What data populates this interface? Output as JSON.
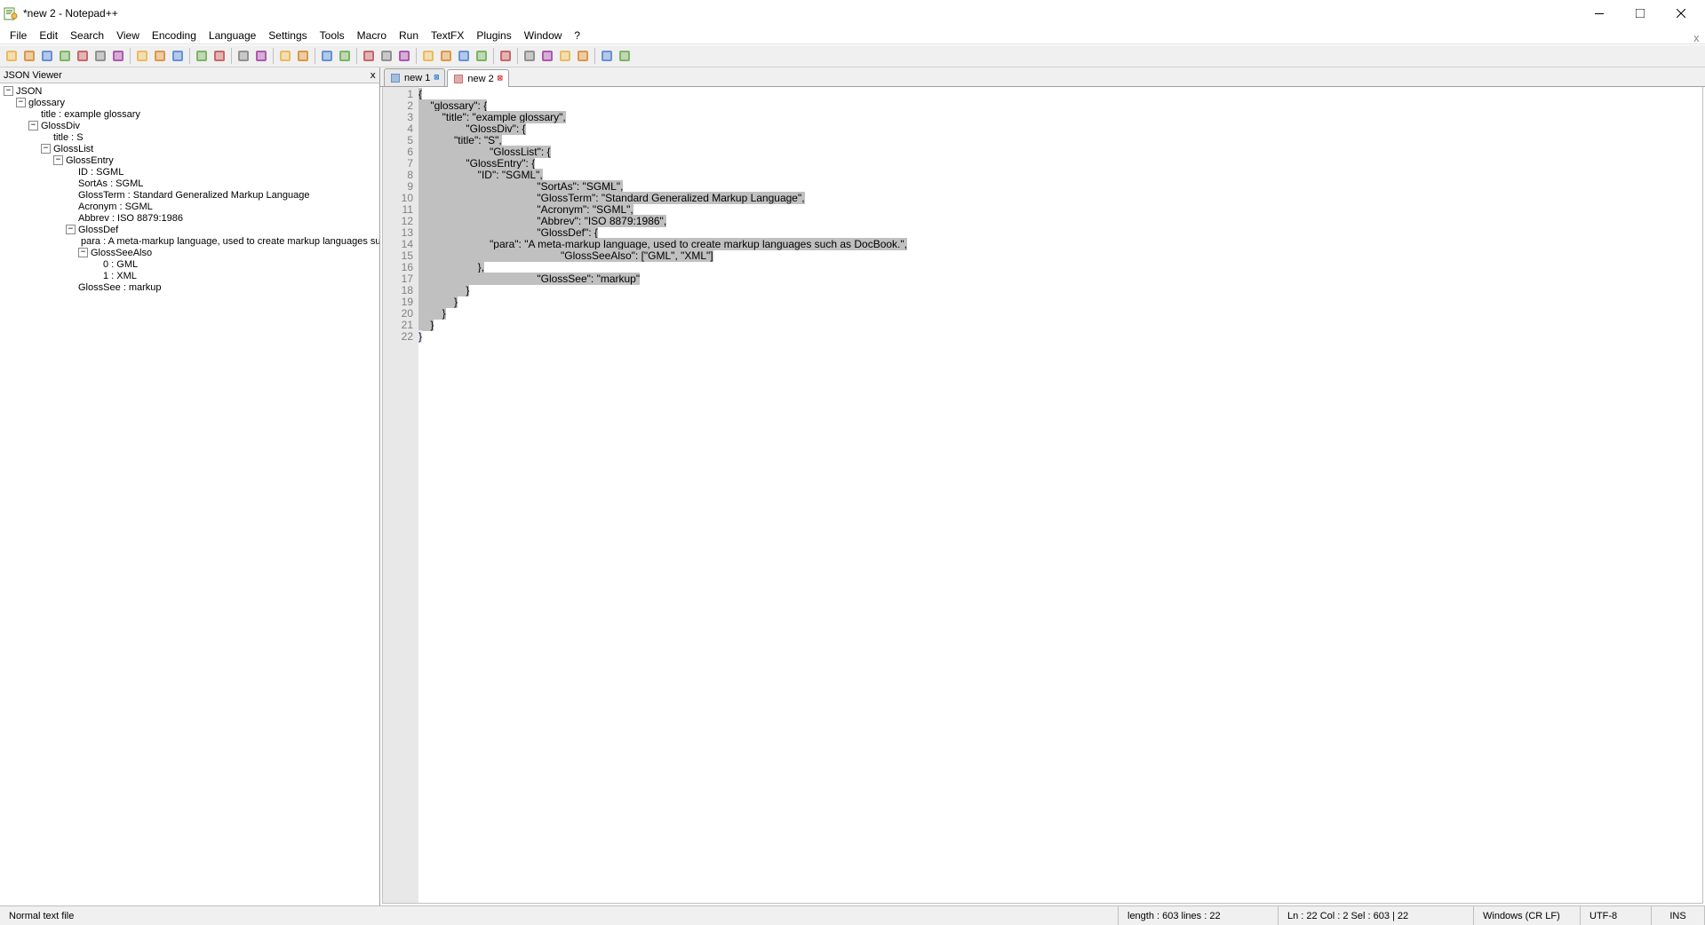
{
  "window": {
    "title": "*new 2 - Notepad++",
    "corner_close": "x"
  },
  "menu": [
    "File",
    "Edit",
    "Search",
    "View",
    "Encoding",
    "Language",
    "Settings",
    "Tools",
    "Macro",
    "Run",
    "TextFX",
    "Plugins",
    "Window",
    "?"
  ],
  "json_panel": {
    "title": "JSON Viewer",
    "close": "x"
  },
  "tree": [
    {
      "indent": 0,
      "toggle": "-",
      "label": "JSON"
    },
    {
      "indent": 1,
      "toggle": "-",
      "label": "glossary"
    },
    {
      "indent": 2,
      "toggle": "",
      "label": "title : example glossary"
    },
    {
      "indent": 2,
      "toggle": "-",
      "label": "GlossDiv"
    },
    {
      "indent": 3,
      "toggle": "",
      "label": "title : S"
    },
    {
      "indent": 3,
      "toggle": "-",
      "label": "GlossList"
    },
    {
      "indent": 4,
      "toggle": "-",
      "label": "GlossEntry"
    },
    {
      "indent": 5,
      "toggle": "",
      "label": "ID : SGML"
    },
    {
      "indent": 5,
      "toggle": "",
      "label": "SortAs : SGML"
    },
    {
      "indent": 5,
      "toggle": "",
      "label": "GlossTerm : Standard Generalized Markup Language"
    },
    {
      "indent": 5,
      "toggle": "",
      "label": "Acronym : SGML"
    },
    {
      "indent": 5,
      "toggle": "",
      "label": "Abbrev : ISO 8879:1986"
    },
    {
      "indent": 5,
      "toggle": "-",
      "label": "GlossDef"
    },
    {
      "indent": 6,
      "toggle": "",
      "label": "para : A meta-markup language, used to create markup languages such as DocBook."
    },
    {
      "indent": 6,
      "toggle": "-",
      "label": "GlossSeeAlso"
    },
    {
      "indent": 7,
      "toggle": "",
      "label": "0 : GML"
    },
    {
      "indent": 7,
      "toggle": "",
      "label": "1 : XML"
    },
    {
      "indent": 5,
      "toggle": "",
      "label": "GlossSee : markup"
    }
  ],
  "tabs": [
    {
      "label": "new 1",
      "active": false,
      "unsaved": false
    },
    {
      "label": "new 2",
      "active": true,
      "unsaved": true
    }
  ],
  "code_lines": [
    "{",
    "    \"glossary\": {",
    "        \"title\": \"example glossary\",",
    "                \"GlossDiv\": {",
    "            \"title\": \"S\",",
    "                        \"GlossList\": {",
    "                \"GlossEntry\": {",
    "                    \"ID\": \"SGML\",",
    "                                        \"SortAs\": \"SGML\",",
    "                                        \"GlossTerm\": \"Standard Generalized Markup Language\",",
    "                                        \"Acronym\": \"SGML\",",
    "                                        \"Abbrev\": \"ISO 8879:1986\",",
    "                                        \"GlossDef\": {",
    "                        \"para\": \"A meta-markup language, used to create markup languages such as DocBook.\",",
    "                                                \"GlossSeeAlso\": [\"GML\", \"XML\"]",
    "                    },",
    "                                        \"GlossSee\": \"markup\"",
    "                }",
    "            }",
    "        }",
    "    }",
    "}"
  ],
  "status": {
    "left": "Normal text file",
    "length_lines": "length : 603    lines : 22",
    "pos": "Ln : 22    Col : 2    Sel : 603 | 22",
    "eol": "Windows (CR LF)",
    "encoding": "UTF-8",
    "mode": "INS"
  },
  "toolbar_icons": [
    "new-file-icon",
    "open-file-icon",
    "save-icon",
    "save-all-icon",
    "close-icon",
    "close-all-icon",
    "print-icon",
    "sep",
    "cut-icon",
    "copy-icon",
    "paste-icon",
    "sep",
    "undo-icon",
    "redo-icon",
    "sep",
    "find-icon",
    "replace-icon",
    "sep",
    "zoom-in-icon",
    "zoom-out-icon",
    "sep",
    "sync-v-icon",
    "sync-h-icon",
    "sep",
    "wrap-icon",
    "all-chars-icon",
    "indent-guide-icon",
    "sep",
    "lang-icon",
    "func-list-icon",
    "folder-icon",
    "doc-map-icon",
    "sep",
    "monitor-icon",
    "sep",
    "record-icon",
    "stop-icon",
    "play-icon",
    "play-multi-icon",
    "sep",
    "spell-icon",
    "about-icon"
  ]
}
